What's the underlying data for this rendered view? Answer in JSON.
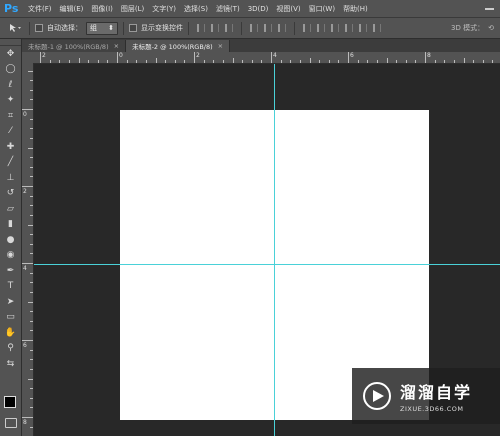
{
  "app": {
    "logo": "Ps",
    "accent": "#31a8ff"
  },
  "menu": [
    "文件(F)",
    "编辑(E)",
    "图像(I)",
    "图层(L)",
    "文字(Y)",
    "选择(S)",
    "滤镜(T)",
    "3D(D)",
    "视图(V)",
    "窗口(W)",
    "帮助(H)"
  ],
  "options": {
    "tool_icon": "move-tool-icon",
    "auto_select_label": "自动选择：",
    "auto_select_value": "组",
    "transform_label": "显示变换控件",
    "mode3d_label": "3D 模式："
  },
  "tabs": [
    {
      "label": "未标题-1 @ 100%(RGB/8)",
      "active": false
    },
    {
      "label": "未标题-2 @ 100%(RGB/8)",
      "active": true
    }
  ],
  "tools": [
    "move-tool-icon",
    "marquee-tool-icon",
    "lasso-tool-icon",
    "magic-wand-icon",
    "crop-tool-icon",
    "eyedropper-icon",
    "healing-brush-icon",
    "brush-icon",
    "clone-stamp-icon",
    "history-brush-icon",
    "eraser-icon",
    "gradient-icon",
    "blur-icon",
    "dodge-icon",
    "pen-icon",
    "type-tool-icon",
    "path-selection-icon",
    "rectangle-tool-icon",
    "hand-tool-icon",
    "zoom-tool-icon"
  ],
  "ruler_h_labels": [
    "2",
    "0",
    "2",
    "4",
    "6",
    "8",
    "10"
  ],
  "ruler_v_labels": [
    "0",
    "2",
    "4",
    "6",
    "8"
  ],
  "guide_color": "#4ad1d8",
  "watermark": {
    "title": "溜溜自学",
    "subtitle": "ZIXUE.3D66.COM"
  }
}
